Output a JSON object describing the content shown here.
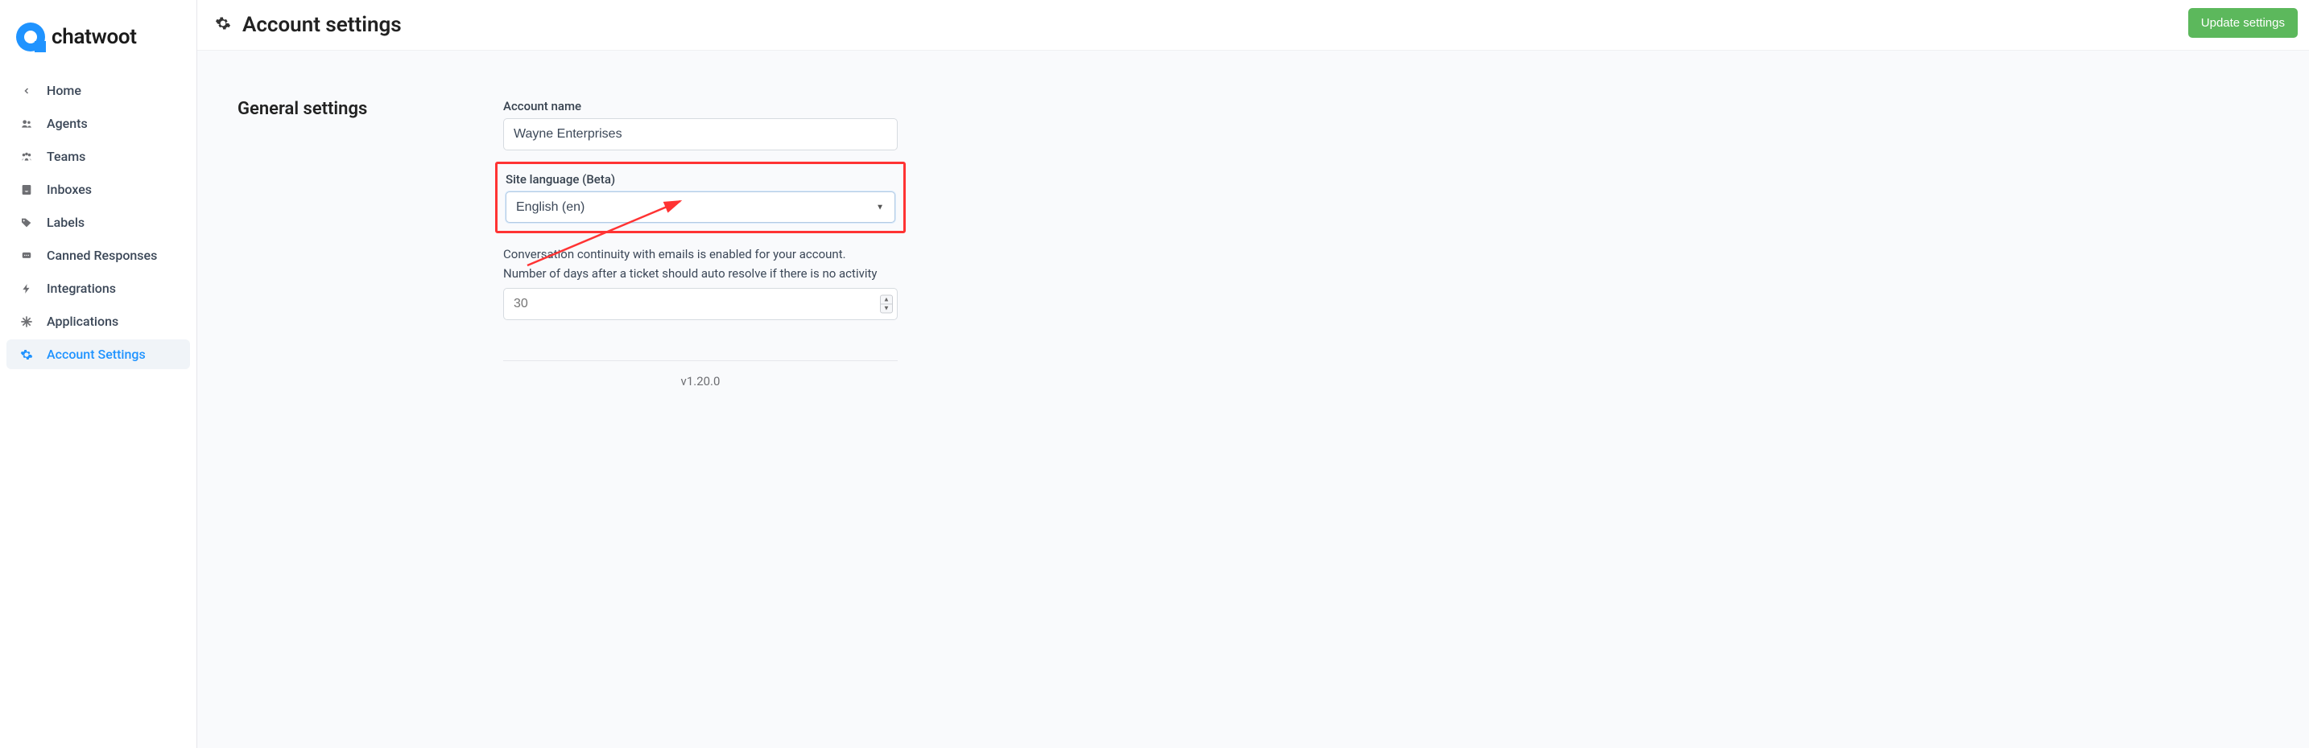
{
  "brand": {
    "name": "chatwoot"
  },
  "sidebar": {
    "items": [
      {
        "label": "Home",
        "icon": "chevron-left"
      },
      {
        "label": "Agents",
        "icon": "agents"
      },
      {
        "label": "Teams",
        "icon": "teams"
      },
      {
        "label": "Inboxes",
        "icon": "inboxes"
      },
      {
        "label": "Labels",
        "icon": "labels"
      },
      {
        "label": "Canned Responses",
        "icon": "canned"
      },
      {
        "label": "Integrations",
        "icon": "integrations"
      },
      {
        "label": "Applications",
        "icon": "applications"
      },
      {
        "label": "Account Settings",
        "icon": "gear",
        "active": true
      }
    ]
  },
  "header": {
    "title": "Account settings",
    "update_button": "Update settings"
  },
  "general": {
    "section_title": "General settings",
    "account_name_label": "Account name",
    "account_name_value": "Wayne Enterprises",
    "language_label": "Site language (Beta)",
    "language_value": "English (en)",
    "continuity_text": "Conversation continuity with emails is enabled for your account.",
    "auto_resolve_text": "Number of days after a ticket should auto resolve if there is no activity",
    "auto_resolve_placeholder": "30"
  },
  "footer": {
    "version": "v1.20.0"
  }
}
